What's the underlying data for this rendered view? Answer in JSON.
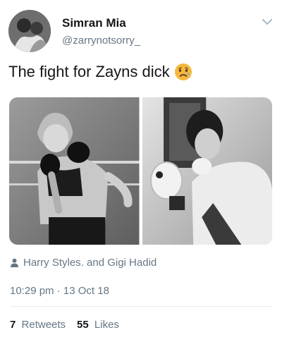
{
  "user": {
    "name": "Simran Mia",
    "handle": "@zarrynotsorry_"
  },
  "tweet": {
    "text": "The fight for Zayns dick",
    "emoji": "sad-tear-face-emoji",
    "tagged_people": "Harry Styles. and Gigi Hadid",
    "timestamp": "10:29 pm · 13 Oct 18"
  },
  "stats": {
    "retweets_count": "7",
    "retweets_label": "Retweets",
    "likes_count": "55",
    "likes_label": "Likes"
  },
  "colors": {
    "text": "#14171a",
    "secondary": "#657786",
    "divider": "#e6ecf0"
  }
}
